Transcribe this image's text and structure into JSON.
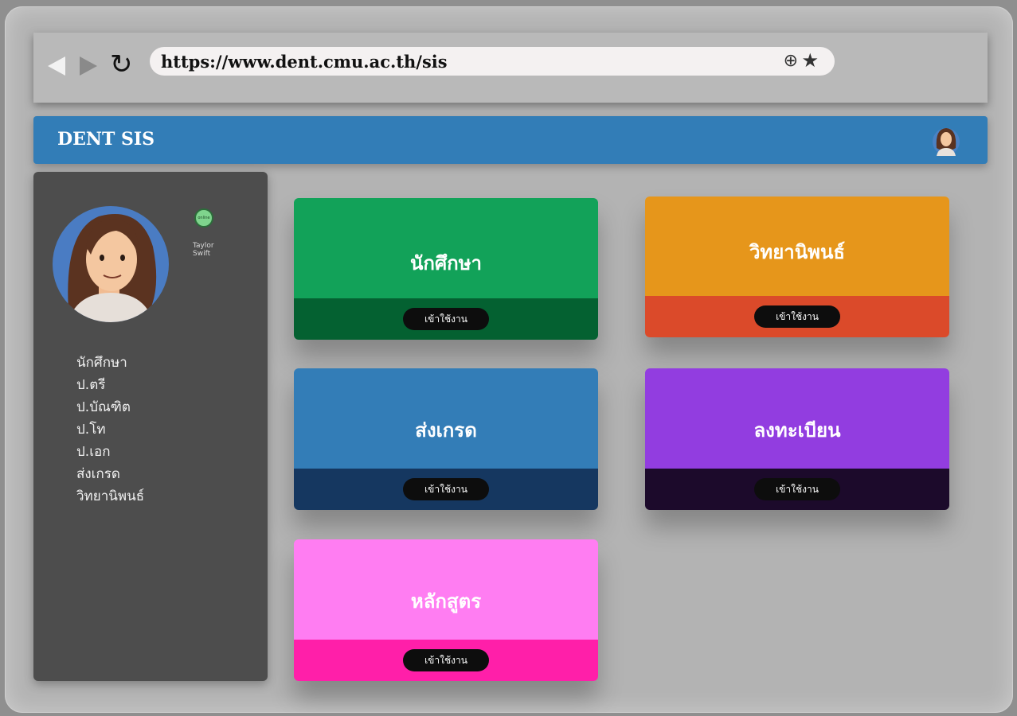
{
  "browser": {
    "url": "https://www.dent.cmu.ac.th/sis",
    "icons": [
      "back-icon",
      "forward-icon",
      "reload-icon",
      "zoom-icon",
      "star-icon"
    ]
  },
  "app": {
    "title": "DENT SIS"
  },
  "sidebar": {
    "status_badge": "online",
    "user_name": "Taylor Swift",
    "menu": [
      "นักศึกษา",
      "ป.ตรี",
      "ป.บัณฑิต",
      "ป.โท",
      "ป.เอก",
      "ส่งเกรด",
      "วิทยานิพนธ์"
    ]
  },
  "cards": [
    {
      "title": "นักศึกษา",
      "button": "เข้าใช้งาน",
      "top_color": "#12a259",
      "bottom_color": "#046131"
    },
    {
      "title": "วิทยานิพนธ์",
      "button": "เข้าใช้งาน",
      "top_color": "#e6961b",
      "bottom_color": "#db4a2a"
    },
    {
      "title": "ส่งเกรด",
      "button": "เข้าใช้งาน",
      "top_color": "#337db7",
      "bottom_color": "#153760"
    },
    {
      "title": "ลงทะเบียน",
      "button": "เข้าใช้งาน",
      "top_color": "#923de0",
      "bottom_color": "#1c0a2b"
    },
    {
      "title": "หลักสูตร",
      "button": "เข้าใช้งาน",
      "top_color": "#ff7df2",
      "bottom_color": "#ff1fa9"
    }
  ]
}
